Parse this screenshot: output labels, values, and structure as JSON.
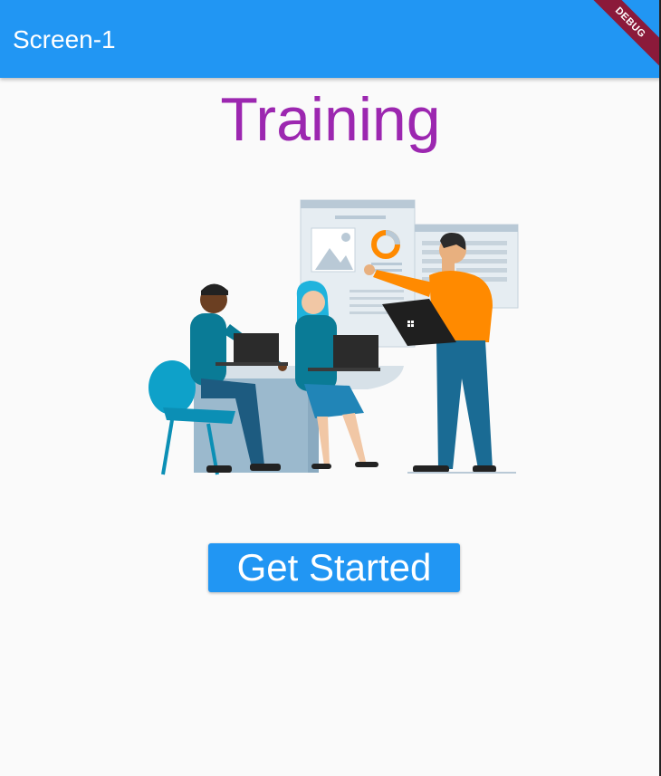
{
  "appbar": {
    "title": "Screen-1",
    "debug_banner": "DEBUG"
  },
  "main": {
    "title": "Training",
    "illustration_icon": "team-training-illustration",
    "cta_label": "Get Started"
  },
  "colors": {
    "appbar": "#2196f3",
    "title": "#9c27b0",
    "button": "#2196f3",
    "background": "#fafafa"
  }
}
